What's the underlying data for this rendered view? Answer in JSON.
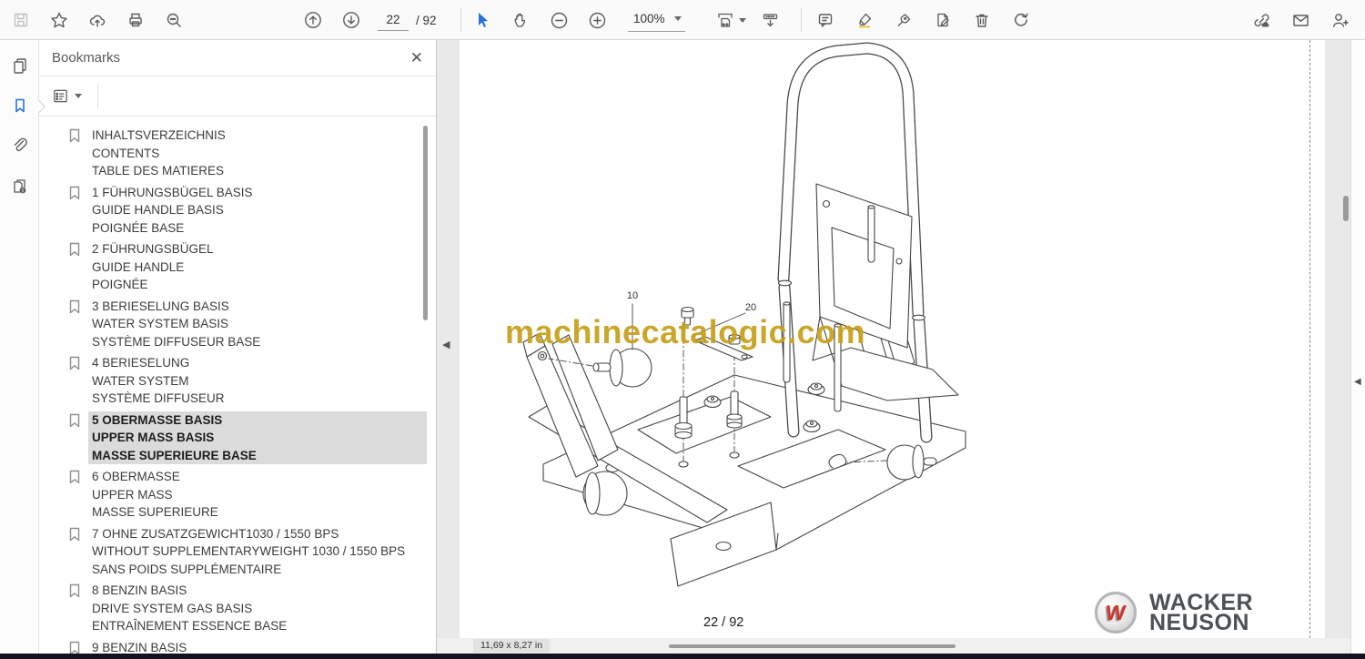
{
  "toolbar": {
    "page_current": "22",
    "page_total_label": "/ 92",
    "zoom_level": "100%"
  },
  "bookmarks_panel": {
    "title": "Bookmarks",
    "close_glyph": "✕",
    "items": [
      {
        "selected": false,
        "lines": [
          "INHALTSVERZEICHNIS",
          "CONTENTS",
          "TABLE DES MATIERES"
        ]
      },
      {
        "selected": false,
        "lines": [
          "1 FÜHRUNGSBÜGEL BASIS",
          "GUIDE HANDLE BASIS",
          "POIGNÉE BASE"
        ]
      },
      {
        "selected": false,
        "lines": [
          "2 FÜHRUNGSBÜGEL",
          "GUIDE HANDLE",
          "POIGNÉE"
        ]
      },
      {
        "selected": false,
        "lines": [
          "3 BERIESELUNG BASIS",
          "WATER SYSTEM BASIS",
          "SYSTÈME DIFFUSEUR BASE"
        ]
      },
      {
        "selected": false,
        "lines": [
          "4 BERIESELUNG",
          "WATER SYSTEM",
          "SYSTÈME DIFFUSEUR"
        ]
      },
      {
        "selected": true,
        "lines": [
          "5 OBERMASSE BASIS",
          "UPPER MASS BASIS",
          "MASSE SUPERIEURE BASE"
        ]
      },
      {
        "selected": false,
        "lines": [
          "6 OBERMASSE",
          "UPPER MASS",
          "MASSE SUPERIEURE"
        ]
      },
      {
        "selected": false,
        "lines": [
          "7 OHNE ZUSATZGEWICHT1030 / 1550 BPS",
          "WITHOUT SUPPLEMENTARYWEIGHT 1030 / 1550 BPS",
          "SANS POIDS SUPPLÉMENTAIRE"
        ]
      },
      {
        "selected": false,
        "lines": [
          "8 BENZIN BASIS",
          "DRIVE SYSTEM GAS BASIS",
          "ENTRAÎNEMENT ESSENCE BASE"
        ]
      },
      {
        "selected": false,
        "lines": [
          "9 BENZIN BASIS"
        ]
      }
    ]
  },
  "document": {
    "watermark": "machinecatalogic.com",
    "callout_10": "10",
    "callout_20": "20",
    "page_footer": "22 / 92",
    "brand_monogram": "W",
    "brand_line1": "WACKER",
    "brand_line2": "NEUSON",
    "size_indicator": "11,69 x 8,27 in",
    "collapse_left_glyph": "◀",
    "collapse_right_glyph": "◀"
  },
  "colors": {
    "accent_blue": "#2574db",
    "watermark_gold": "#c7a11c",
    "brand_red": "#d0342c",
    "brand_gray": "#4c5156",
    "selection_gray": "#dbdbdb"
  }
}
